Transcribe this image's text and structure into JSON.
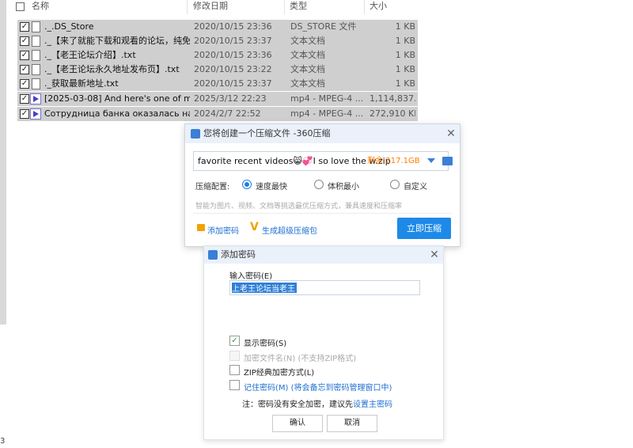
{
  "explorer": {
    "columns": {
      "name": "名称",
      "date": "修改日期",
      "type": "类型",
      "size": "大小"
    },
    "files": [
      {
        "name": "._.DS_Store",
        "date": "2020/10/15 23:36",
        "type": "DS_STORE 文件",
        "size": "1 KB",
        "icon": "file-icon"
      },
      {
        "name": "._【来了就能下载和观看的论坛，纯免...",
        "date": "2020/10/15 23:37",
        "type": "文本文档",
        "size": "1 KB",
        "icon": "file-icon"
      },
      {
        "name": "._【老王论坛介绍】.txt",
        "date": "2020/10/15 23:36",
        "type": "文本文档",
        "size": "1 KB",
        "icon": "file-icon"
      },
      {
        "name": "._【老王论坛永久地址发布页】.txt",
        "date": "2020/10/15 23:22",
        "type": "文本文档",
        "size": "1 KB",
        "icon": "file-icon"
      },
      {
        "name": "._获取最新地址.txt",
        "date": "2020/10/15 23:37",
        "type": "文本文档",
        "size": "1 KB",
        "icon": "file-icon"
      },
      {
        "name": "[2025-03-08] And here's one of m...",
        "date": "2025/3/12 22:23",
        "type": "mp4 - MPEG-4 ...",
        "size": "1,114,837...",
        "icon": "video-icon"
      },
      {
        "name": "Сотрудница банка оказалась наст...",
        "date": "2024/2/7 22:52",
        "type": "mp4 - MPEG-4 ...",
        "size": "272,910 KB",
        "icon": "video-icon"
      }
    ],
    "edge_digit": "3"
  },
  "zip_dialog": {
    "title": "您将创建一个压缩文件 -360压缩",
    "path": "favorite recent videos😸💞I so love the w.zip",
    "free_space": "剩余:217.1GB",
    "config_label": "压缩配置:",
    "options": [
      "速度最快",
      "体积最小",
      "自定义"
    ],
    "selected_option": "速度最快",
    "hint": "智能为图片、视频、文档等挑选最优压缩方式，兼具速度和压缩率",
    "add_password": "添加密码",
    "super_package": "生成超级压缩包",
    "compress_button": "立即压缩"
  },
  "pw_dialog": {
    "title": "添加密码",
    "input_label": "输入密码(E)",
    "password_value": "上老王论坛当老王",
    "show_password": "显示密码(S)",
    "encrypt_names": "加密文件名(N) (不支持ZIP格式)",
    "zip_classic": "ZIP经典加密方式(L)",
    "remember": "记住密码(M) (将会备忘到密码管理窗口中)",
    "note_prefix": "注：密码没有安全加密，建议先",
    "note_link": "设置主密码",
    "ok_button": "确认",
    "cancel_button": "取消"
  },
  "colors": {
    "accent": "#1e8ae8",
    "selection_row": "#cfcfcf",
    "warning": "#ff7d00",
    "check_green": "#2aa040"
  }
}
